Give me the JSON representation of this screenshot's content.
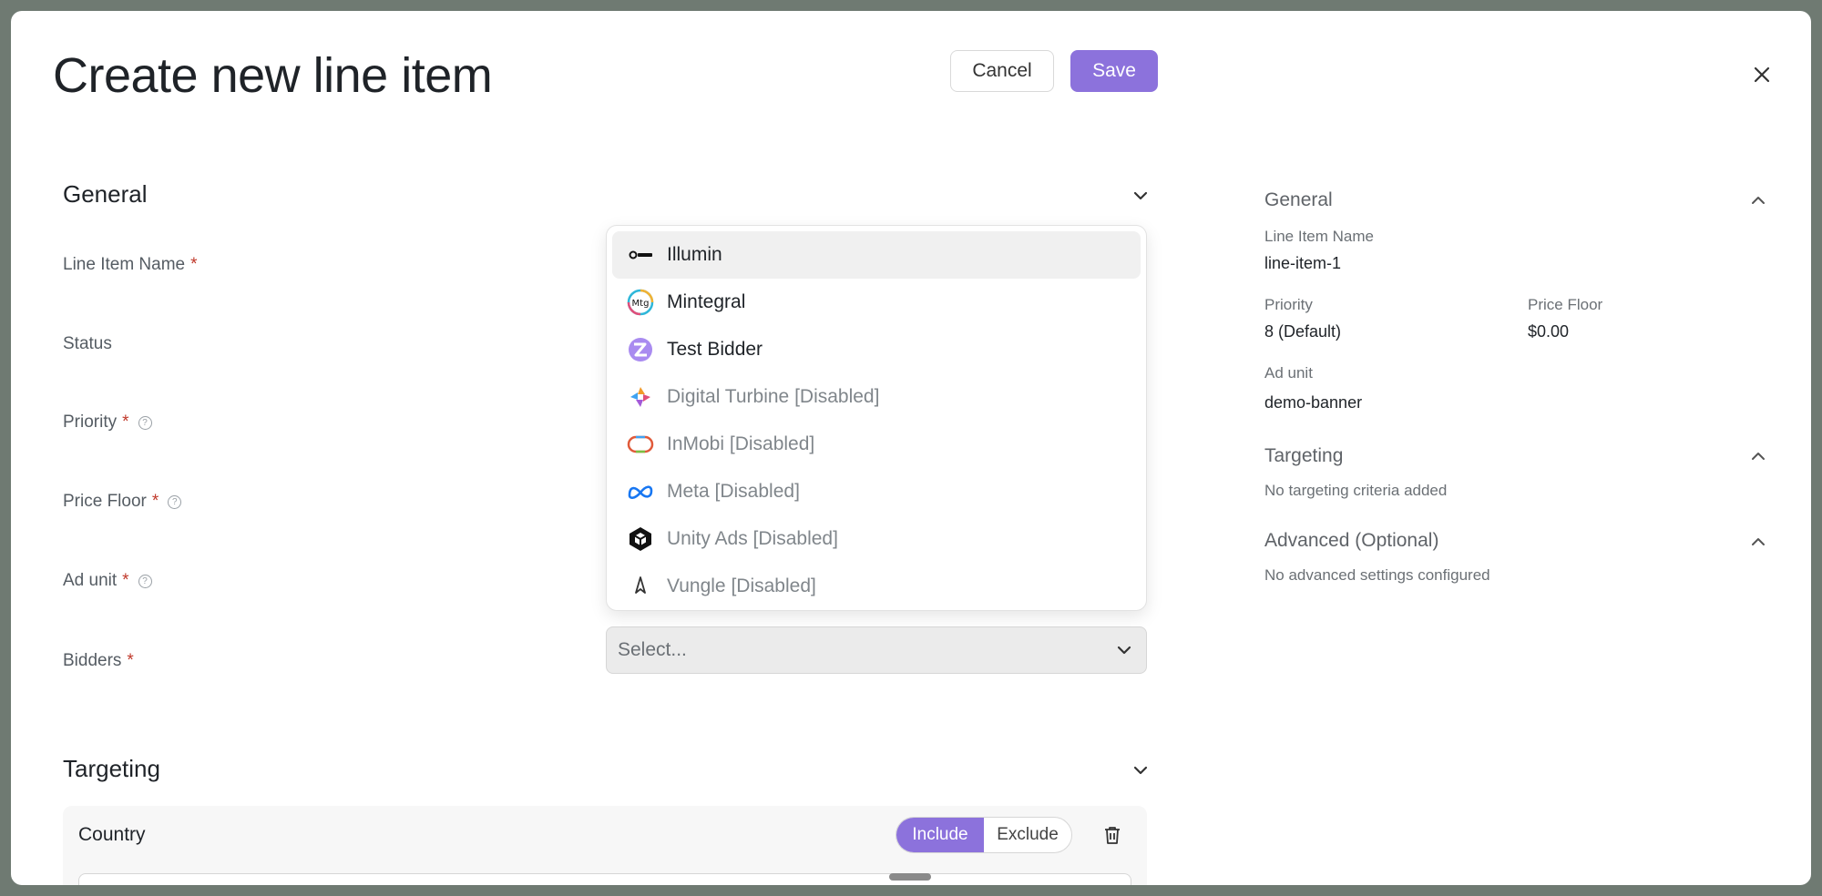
{
  "header": {
    "title": "Create new line item",
    "cancel": "Cancel",
    "save": "Save"
  },
  "form": {
    "general_title": "General",
    "labels": {
      "line_item_name": "Line Item Name",
      "status": "Status",
      "priority": "Priority",
      "price_floor": "Price Floor",
      "ad_unit": "Ad unit",
      "bidders": "Bidders"
    },
    "required_mark": "*",
    "help_glyph": "?",
    "bidders_placeholder": "Select...",
    "targeting_title": "Targeting",
    "country_label": "Country",
    "include": "Include",
    "exclude": "Exclude"
  },
  "dropdown": {
    "options": [
      {
        "label": "Illumin",
        "icon": "illumin-logo",
        "disabled": false,
        "hovered": true
      },
      {
        "label": "Mintegral",
        "icon": "mintegral-logo",
        "disabled": false
      },
      {
        "label": "Test Bidder",
        "icon": "test-bidder-logo",
        "disabled": false
      },
      {
        "label": "Digital Turbine [Disabled]",
        "icon": "digital-turbine-logo",
        "disabled": true
      },
      {
        "label": "InMobi [Disabled]",
        "icon": "inmobi-logo",
        "disabled": true
      },
      {
        "label": "Meta [Disabled]",
        "icon": "meta-logo",
        "disabled": true
      },
      {
        "label": "Unity Ads [Disabled]",
        "icon": "unity-logo",
        "disabled": true
      },
      {
        "label": "Vungle [Disabled]",
        "icon": "vungle-logo",
        "disabled": true
      }
    ]
  },
  "summary": {
    "general_title": "General",
    "line_item_name_label": "Line Item Name",
    "line_item_name_value": "line-item-1",
    "priority_label": "Priority",
    "priority_value": "8 (Default)",
    "price_floor_label": "Price Floor",
    "price_floor_value": "$0.00",
    "ad_unit_label": "Ad unit",
    "ad_unit_value": "demo-banner",
    "targeting_title": "Targeting",
    "targeting_note": "No targeting criteria added",
    "advanced_title": "Advanced (Optional)",
    "advanced_note": "No advanced settings configured"
  },
  "colors": {
    "accent": "#8c72dc",
    "required": "#c0392b"
  }
}
